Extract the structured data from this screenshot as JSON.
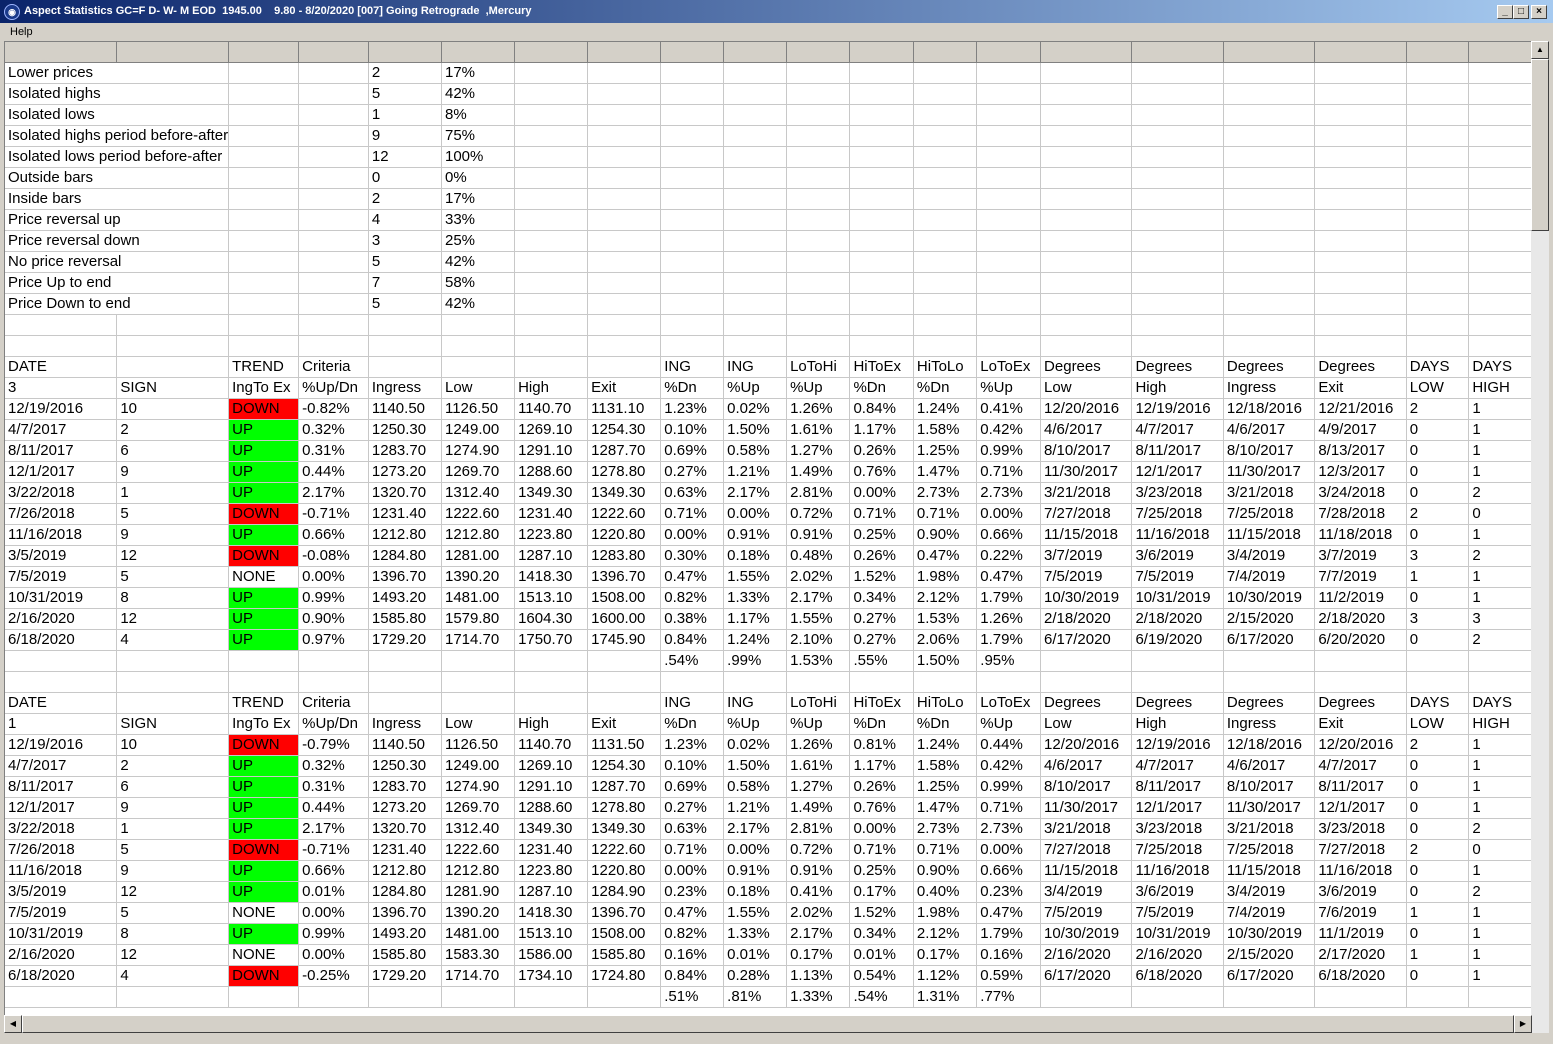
{
  "window": {
    "title": "Aspect Statistics GC=F D- W- M EOD  1945.00    9.80 - 8/20/2020 [007] Going Retrograde  ,Mercury",
    "icon": "app-globe-icon",
    "minimize_glyph": "_",
    "maximize_glyph": "□",
    "close_glyph": "×"
  },
  "menu": {
    "help": "Help"
  },
  "colors": {
    "up": "#00ff00",
    "down": "#ff0000",
    "titlebar": "#0a246a"
  },
  "summary": [
    {
      "label": "Lower prices",
      "count": "2",
      "pct": "17%"
    },
    {
      "label": "Isolated highs",
      "count": "5",
      "pct": "42%"
    },
    {
      "label": "Isolated lows",
      "count": "1",
      "pct": "8%"
    },
    {
      "label": "Isolated highs period before-after",
      "count": "9",
      "pct": "75%"
    },
    {
      "label": "Isolated lows period before-after",
      "count": "12",
      "pct": "100%"
    },
    {
      "label": "Outside bars",
      "count": "0",
      "pct": "0%"
    },
    {
      "label": "Inside bars",
      "count": "2",
      "pct": "17%"
    },
    {
      "label": "Price reversal up",
      "count": "4",
      "pct": "33%"
    },
    {
      "label": "Price reversal down",
      "count": "3",
      "pct": "25%"
    },
    {
      "label": "No price reversal",
      "count": "5",
      "pct": "42%"
    },
    {
      "label": "Price Up to end",
      "count": "7",
      "pct": "58%"
    },
    {
      "label": "Price Down to end",
      "count": "5",
      "pct": "42%"
    }
  ],
  "header_row1": [
    "DATE",
    "",
    "TREND",
    "Criteria",
    "",
    "",
    "",
    "",
    "ING",
    "ING",
    "LoToHi",
    "HiToEx",
    "HiToLo",
    "LoToEx",
    "Degrees",
    "Degrees",
    "Degrees",
    "Degrees",
    "DAYS",
    "DAYS"
  ],
  "header_row2": [
    "SIGN",
    "IngTo Ex",
    "%Up/Dn",
    "Ingress",
    "Low",
    "High",
    "Exit",
    "%Dn",
    "%Up",
    "%Up",
    "%Dn",
    "%Dn",
    "%Up",
    "Low",
    "High",
    "Ingress",
    "Exit",
    "LOW",
    "HIGH"
  ],
  "sections": [
    {
      "id": "3",
      "rows": [
        [
          "12/19/2016",
          "10",
          "DOWN",
          "-0.82%",
          "1140.50",
          "1126.50",
          "1140.70",
          "1131.10",
          "1.23%",
          "0.02%",
          "1.26%",
          "0.84%",
          "1.24%",
          "0.41%",
          "12/20/2016",
          "12/19/2016",
          "12/18/2016",
          "12/21/2016",
          "2",
          "1"
        ],
        [
          "4/7/2017",
          "2",
          "UP",
          "0.32%",
          "1250.30",
          "1249.00",
          "1269.10",
          "1254.30",
          "0.10%",
          "1.50%",
          "1.61%",
          "1.17%",
          "1.58%",
          "0.42%",
          "4/6/2017",
          "4/7/2017",
          "4/6/2017",
          "4/9/2017",
          "0",
          "1"
        ],
        [
          "8/11/2017",
          "6",
          "UP",
          "0.31%",
          "1283.70",
          "1274.90",
          "1291.10",
          "1287.70",
          "0.69%",
          "0.58%",
          "1.27%",
          "0.26%",
          "1.25%",
          "0.99%",
          "8/10/2017",
          "8/11/2017",
          "8/10/2017",
          "8/13/2017",
          "0",
          "1"
        ],
        [
          "12/1/2017",
          "9",
          "UP",
          "0.44%",
          "1273.20",
          "1269.70",
          "1288.60",
          "1278.80",
          "0.27%",
          "1.21%",
          "1.49%",
          "0.76%",
          "1.47%",
          "0.71%",
          "11/30/2017",
          "12/1/2017",
          "11/30/2017",
          "12/3/2017",
          "0",
          "1"
        ],
        [
          "3/22/2018",
          "1",
          "UP",
          "2.17%",
          "1320.70",
          "1312.40",
          "1349.30",
          "1349.30",
          "0.63%",
          "2.17%",
          "2.81%",
          "0.00%",
          "2.73%",
          "2.73%",
          "3/21/2018",
          "3/23/2018",
          "3/21/2018",
          "3/24/2018",
          "0",
          "2"
        ],
        [
          "7/26/2018",
          "5",
          "DOWN",
          "-0.71%",
          "1231.40",
          "1222.60",
          "1231.40",
          "1222.60",
          "0.71%",
          "0.00%",
          "0.72%",
          "0.71%",
          "0.71%",
          "0.00%",
          "7/27/2018",
          "7/25/2018",
          "7/25/2018",
          "7/28/2018",
          "2",
          "0"
        ],
        [
          "11/16/2018",
          "9",
          "UP",
          "0.66%",
          "1212.80",
          "1212.80",
          "1223.80",
          "1220.80",
          "0.00%",
          "0.91%",
          "0.91%",
          "0.25%",
          "0.90%",
          "0.66%",
          "11/15/2018",
          "11/16/2018",
          "11/15/2018",
          "11/18/2018",
          "0",
          "1"
        ],
        [
          "3/5/2019",
          "12",
          "DOWN",
          "-0.08%",
          "1284.80",
          "1281.00",
          "1287.10",
          "1283.80",
          "0.30%",
          "0.18%",
          "0.48%",
          "0.26%",
          "0.47%",
          "0.22%",
          "3/7/2019",
          "3/6/2019",
          "3/4/2019",
          "3/7/2019",
          "3",
          "2"
        ],
        [
          "7/5/2019",
          "5",
          "NONE",
          "0.00%",
          "1396.70",
          "1390.20",
          "1418.30",
          "1396.70",
          "0.47%",
          "1.55%",
          "2.02%",
          "1.52%",
          "1.98%",
          "0.47%",
          "7/5/2019",
          "7/5/2019",
          "7/4/2019",
          "7/7/2019",
          "1",
          "1"
        ],
        [
          "10/31/2019",
          "8",
          "UP",
          "0.99%",
          "1493.20",
          "1481.00",
          "1513.10",
          "1508.00",
          "0.82%",
          "1.33%",
          "2.17%",
          "0.34%",
          "2.12%",
          "1.79%",
          "10/30/2019",
          "10/31/2019",
          "10/30/2019",
          "11/2/2019",
          "0",
          "1"
        ],
        [
          "2/16/2020",
          "12",
          "UP",
          "0.90%",
          "1585.80",
          "1579.80",
          "1604.30",
          "1600.00",
          "0.38%",
          "1.17%",
          "1.55%",
          "0.27%",
          "1.53%",
          "1.26%",
          "2/18/2020",
          "2/18/2020",
          "2/15/2020",
          "2/18/2020",
          "3",
          "3"
        ],
        [
          "6/18/2020",
          "4",
          "UP",
          "0.97%",
          "1729.20",
          "1714.70",
          "1750.70",
          "1745.90",
          "0.84%",
          "1.24%",
          "2.10%",
          "0.27%",
          "2.06%",
          "1.79%",
          "6/17/2020",
          "6/19/2020",
          "6/17/2020",
          "6/20/2020",
          "0",
          "2"
        ]
      ],
      "averages": [
        ".54%",
        ".99%",
        "1.53%",
        ".55%",
        "1.50%",
        ".95%"
      ]
    },
    {
      "id": "1",
      "rows": [
        [
          "12/19/2016",
          "10",
          "DOWN",
          "-0.79%",
          "1140.50",
          "1126.50",
          "1140.70",
          "1131.50",
          "1.23%",
          "0.02%",
          "1.26%",
          "0.81%",
          "1.24%",
          "0.44%",
          "12/20/2016",
          "12/19/2016",
          "12/18/2016",
          "12/20/2016",
          "2",
          "1"
        ],
        [
          "4/7/2017",
          "2",
          "UP",
          "0.32%",
          "1250.30",
          "1249.00",
          "1269.10",
          "1254.30",
          "0.10%",
          "1.50%",
          "1.61%",
          "1.17%",
          "1.58%",
          "0.42%",
          "4/6/2017",
          "4/7/2017",
          "4/6/2017",
          "4/7/2017",
          "0",
          "1"
        ],
        [
          "8/11/2017",
          "6",
          "UP",
          "0.31%",
          "1283.70",
          "1274.90",
          "1291.10",
          "1287.70",
          "0.69%",
          "0.58%",
          "1.27%",
          "0.26%",
          "1.25%",
          "0.99%",
          "8/10/2017",
          "8/11/2017",
          "8/10/2017",
          "8/11/2017",
          "0",
          "1"
        ],
        [
          "12/1/2017",
          "9",
          "UP",
          "0.44%",
          "1273.20",
          "1269.70",
          "1288.60",
          "1278.80",
          "0.27%",
          "1.21%",
          "1.49%",
          "0.76%",
          "1.47%",
          "0.71%",
          "11/30/2017",
          "12/1/2017",
          "11/30/2017",
          "12/1/2017",
          "0",
          "1"
        ],
        [
          "3/22/2018",
          "1",
          "UP",
          "2.17%",
          "1320.70",
          "1312.40",
          "1349.30",
          "1349.30",
          "0.63%",
          "2.17%",
          "2.81%",
          "0.00%",
          "2.73%",
          "2.73%",
          "3/21/2018",
          "3/23/2018",
          "3/21/2018",
          "3/23/2018",
          "0",
          "2"
        ],
        [
          "7/26/2018",
          "5",
          "DOWN",
          "-0.71%",
          "1231.40",
          "1222.60",
          "1231.40",
          "1222.60",
          "0.71%",
          "0.00%",
          "0.72%",
          "0.71%",
          "0.71%",
          "0.00%",
          "7/27/2018",
          "7/25/2018",
          "7/25/2018",
          "7/27/2018",
          "2",
          "0"
        ],
        [
          "11/16/2018",
          "9",
          "UP",
          "0.66%",
          "1212.80",
          "1212.80",
          "1223.80",
          "1220.80",
          "0.00%",
          "0.91%",
          "0.91%",
          "0.25%",
          "0.90%",
          "0.66%",
          "11/15/2018",
          "11/16/2018",
          "11/15/2018",
          "11/16/2018",
          "0",
          "1"
        ],
        [
          "3/5/2019",
          "12",
          "UP",
          "0.01%",
          "1284.80",
          "1281.90",
          "1287.10",
          "1284.90",
          "0.23%",
          "0.18%",
          "0.41%",
          "0.17%",
          "0.40%",
          "0.23%",
          "3/4/2019",
          "3/6/2019",
          "3/4/2019",
          "3/6/2019",
          "0",
          "2"
        ],
        [
          "7/5/2019",
          "5",
          "NONE",
          "0.00%",
          "1396.70",
          "1390.20",
          "1418.30",
          "1396.70",
          "0.47%",
          "1.55%",
          "2.02%",
          "1.52%",
          "1.98%",
          "0.47%",
          "7/5/2019",
          "7/5/2019",
          "7/4/2019",
          "7/6/2019",
          "1",
          "1"
        ],
        [
          "10/31/2019",
          "8",
          "UP",
          "0.99%",
          "1493.20",
          "1481.00",
          "1513.10",
          "1508.00",
          "0.82%",
          "1.33%",
          "2.17%",
          "0.34%",
          "2.12%",
          "1.79%",
          "10/30/2019",
          "10/31/2019",
          "10/30/2019",
          "11/1/2019",
          "0",
          "1"
        ],
        [
          "2/16/2020",
          "12",
          "NONE",
          "0.00%",
          "1585.80",
          "1583.30",
          "1586.00",
          "1585.80",
          "0.16%",
          "0.01%",
          "0.17%",
          "0.01%",
          "0.17%",
          "0.16%",
          "2/16/2020",
          "2/16/2020",
          "2/15/2020",
          "2/17/2020",
          "1",
          "1"
        ],
        [
          "6/18/2020",
          "4",
          "DOWN",
          "-0.25%",
          "1729.20",
          "1714.70",
          "1734.10",
          "1724.80",
          "0.84%",
          "0.28%",
          "1.13%",
          "0.54%",
          "1.12%",
          "0.59%",
          "6/17/2020",
          "6/18/2020",
          "6/17/2020",
          "6/18/2020",
          "0",
          "1"
        ]
      ],
      "averages": [
        ".51%",
        ".81%",
        "1.33%",
        ".54%",
        "1.31%",
        ".77%"
      ]
    }
  ]
}
